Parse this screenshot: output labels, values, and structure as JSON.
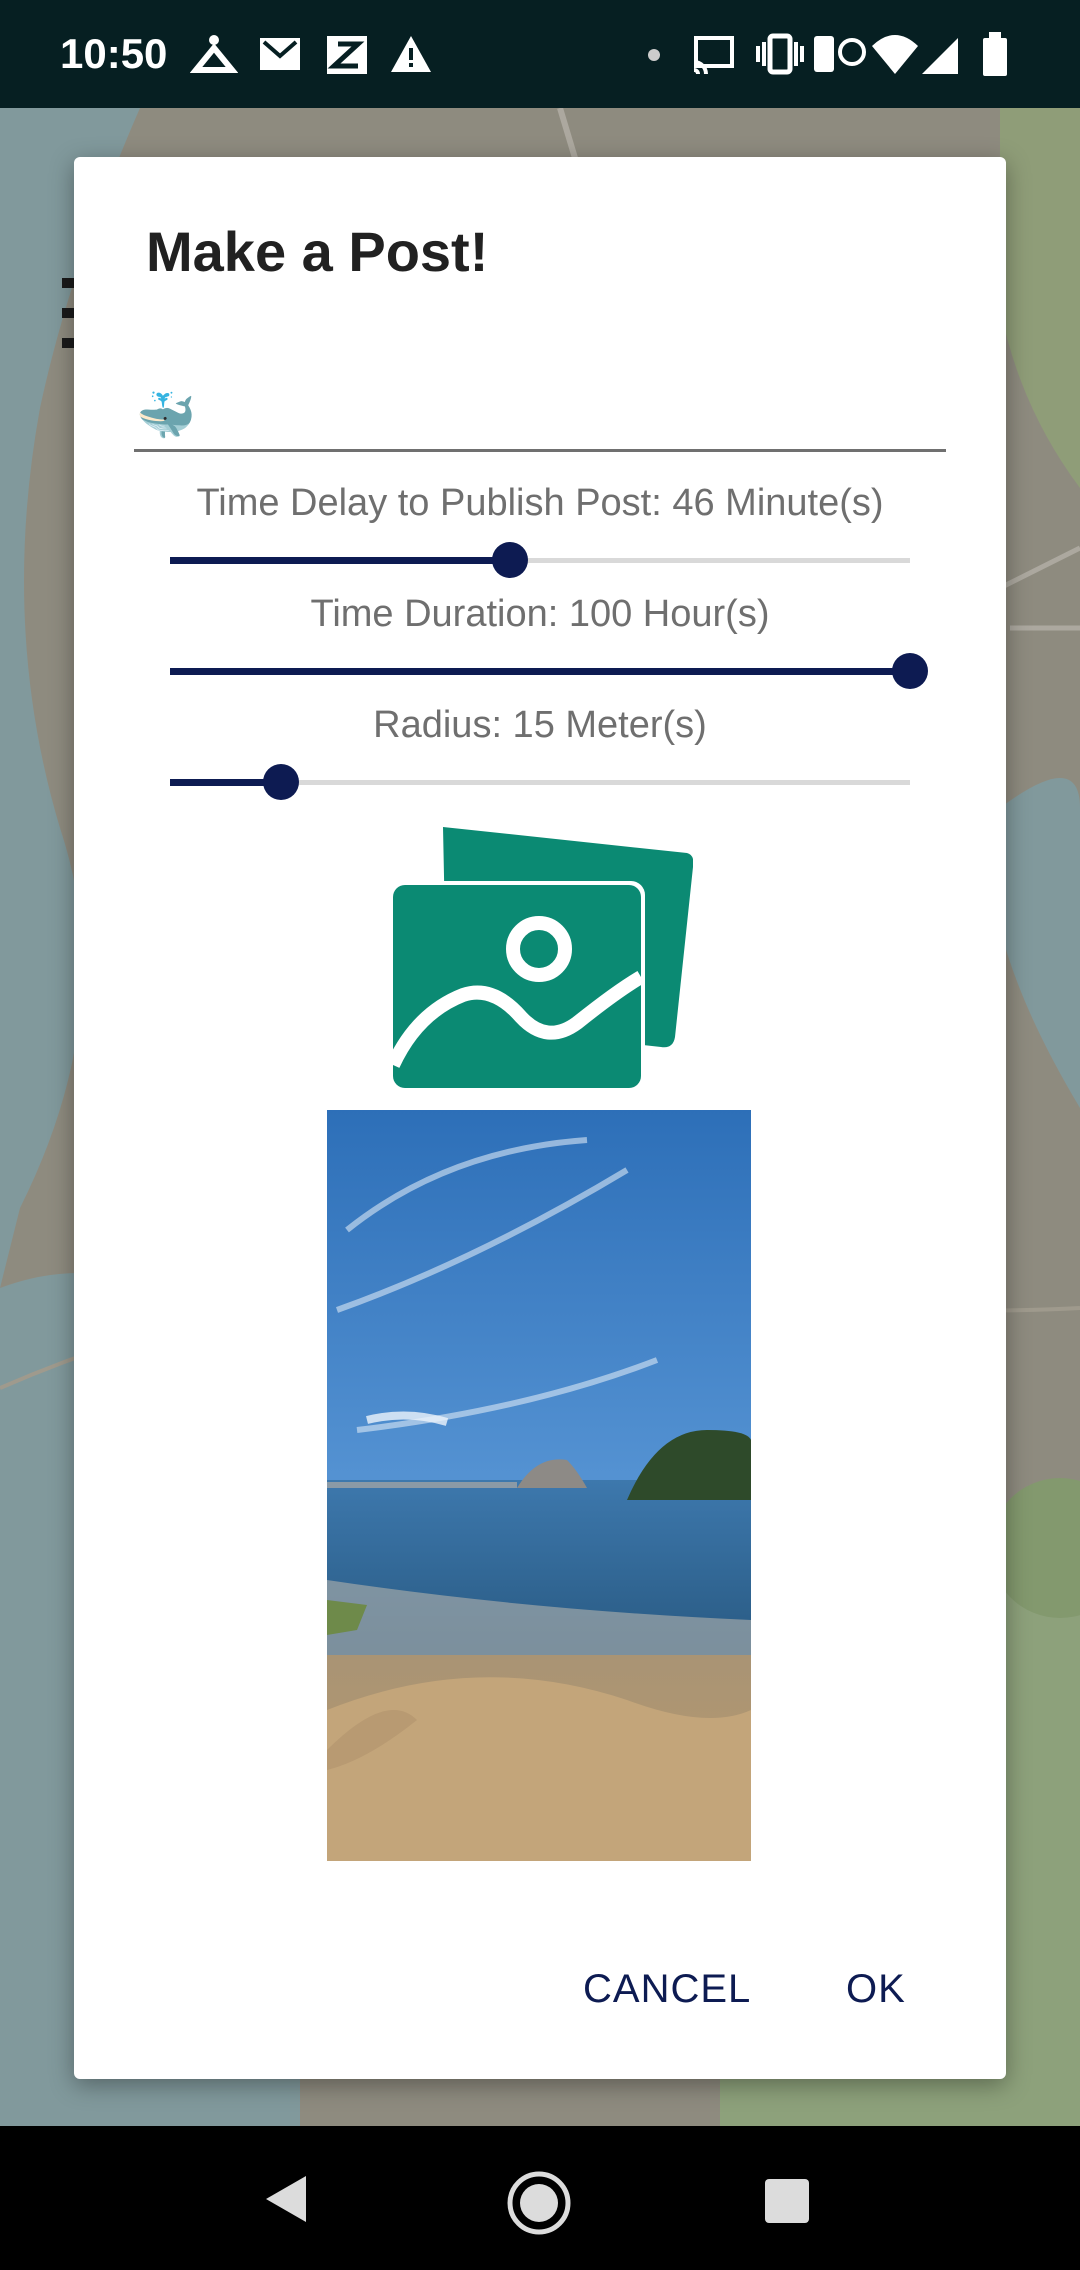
{
  "status_bar": {
    "time": "10:50",
    "icons": [
      "bug-icon",
      "gmail-icon",
      "app-icon",
      "warning-icon",
      "dot-icon",
      "cast-icon",
      "vibrate-icon",
      "hotspot-icon",
      "wifi-icon",
      "signal-icon",
      "battery-icon"
    ]
  },
  "dialog": {
    "title": "Make a Post!",
    "post_text": "🐳",
    "time_delay": {
      "label": "Time Delay to Publish Post: 46 Minute(s)",
      "fraction": 0.46
    },
    "time_duration": {
      "label": "Time Duration: 100 Hour(s)",
      "fraction": 1.0
    },
    "radius": {
      "label": "Radius: 15 Meter(s)",
      "fraction": 0.15
    },
    "gallery_icon": "image-gallery-icon",
    "photo": "beach-photo",
    "cancel_label": "CANCEL",
    "ok_label": "OK"
  },
  "nav_bar": {
    "icons": [
      "back-icon",
      "home-icon",
      "recents-icon"
    ]
  },
  "colors": {
    "accent": "#0d1b52",
    "gallery": "#0b8a73",
    "status_bar": "#061f22"
  }
}
